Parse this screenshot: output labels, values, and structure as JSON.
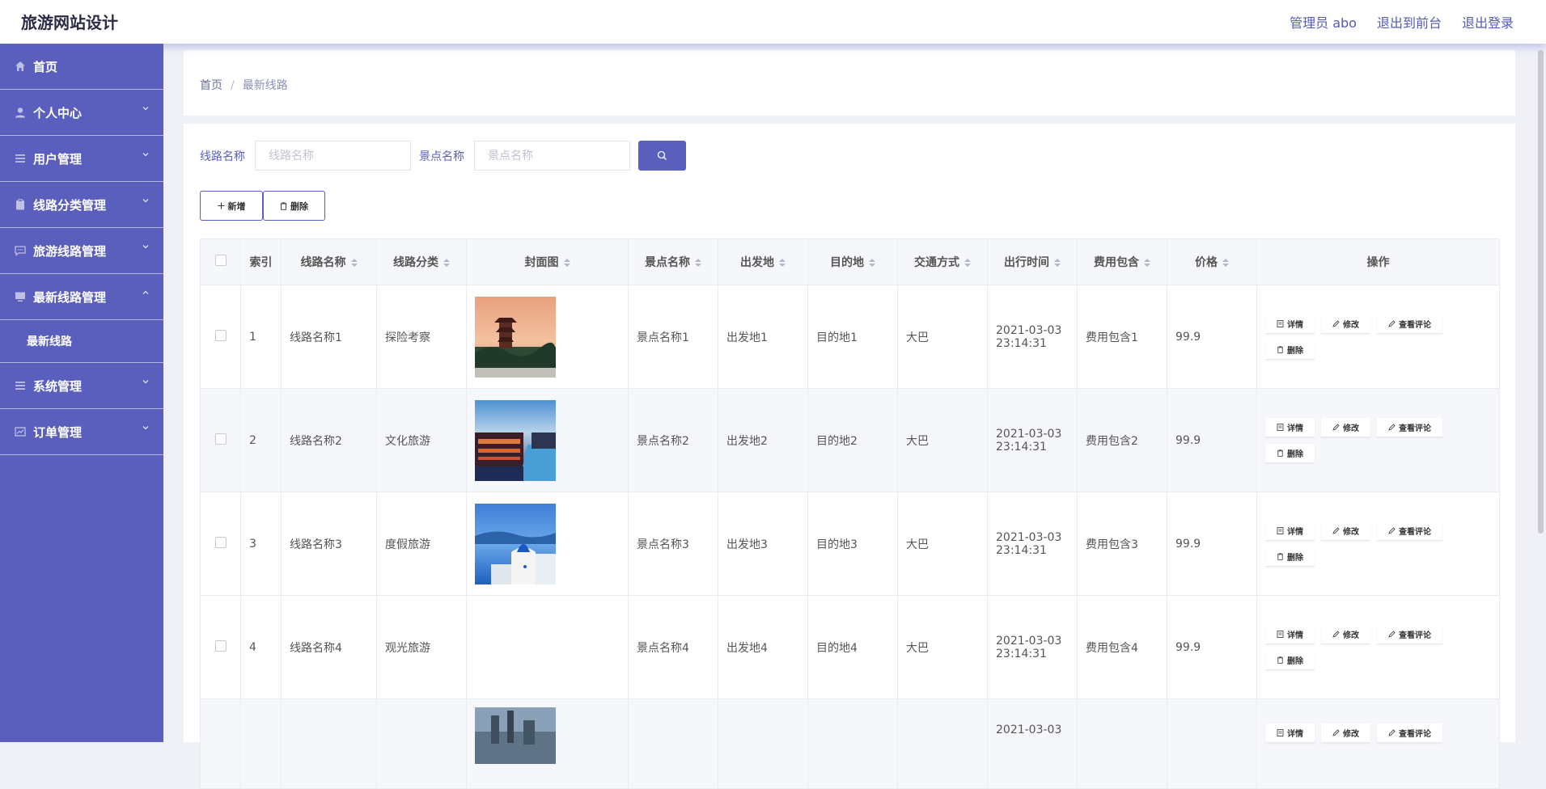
{
  "brand": "旅游网站设计",
  "topnav": {
    "user": "管理员 abo",
    "to_front": "退出到前台",
    "logout": "退出登录"
  },
  "sidebar": {
    "items": [
      {
        "label": "首页",
        "icon": "home-icon"
      },
      {
        "label": "个人中心",
        "icon": "user-icon"
      },
      {
        "label": "用户管理",
        "icon": "list-icon"
      },
      {
        "label": "线路分类管理",
        "icon": "clipboard-icon"
      },
      {
        "label": "旅游线路管理",
        "icon": "chat-icon"
      },
      {
        "label": "最新线路管理",
        "icon": "monitor-icon"
      },
      {
        "label": "系统管理",
        "icon": "list-icon"
      },
      {
        "label": "订单管理",
        "icon": "chart-icon"
      }
    ],
    "sub_item": "最新线路"
  },
  "breadcrumb": {
    "home": "首页",
    "sep": "/",
    "current": "最新线路"
  },
  "search": {
    "route_label": "线路名称",
    "route_placeholder": "线路名称",
    "spot_label": "景点名称",
    "spot_placeholder": "景点名称"
  },
  "actions": {
    "add": "新增",
    "delete": "删除"
  },
  "table": {
    "headers": [
      "索引",
      "线路名称",
      "线路分类",
      "封面图",
      "景点名称",
      "出发地",
      "目的地",
      "交通方式",
      "出行时间",
      "费用包含",
      "价格",
      "操作"
    ],
    "ops": {
      "detail": "详情",
      "edit": "修改",
      "comments": "查看评论",
      "delete": "删除"
    },
    "rows": [
      {
        "idx": "1",
        "name": "线路名称1",
        "category": "探险考察",
        "spot": "景点名称1",
        "from": "出发地1",
        "to": "目的地1",
        "transport": "大巴",
        "date": "2021-03-03",
        "time": "23:14:31",
        "fee": "费用包含1",
        "price": "99.9",
        "cover": "pagoda-sunset"
      },
      {
        "idx": "2",
        "name": "线路名称2",
        "category": "文化旅游",
        "spot": "景点名称2",
        "from": "出发地2",
        "to": "目的地2",
        "transport": "大巴",
        "date": "2021-03-03",
        "time": "23:14:31",
        "fee": "费用包含2",
        "price": "99.9",
        "cover": "water-town-night"
      },
      {
        "idx": "3",
        "name": "线路名称3",
        "category": "度假旅游",
        "spot": "景点名称3",
        "from": "出发地3",
        "to": "目的地3",
        "transport": "大巴",
        "date": "2021-03-03",
        "time": "23:14:31",
        "fee": "费用包含3",
        "price": "99.9",
        "cover": "santorini"
      },
      {
        "idx": "4",
        "name": "线路名称4",
        "category": "观光旅游",
        "spot": "景点名称4",
        "from": "出发地4",
        "to": "目的地4",
        "transport": "大巴",
        "date": "2021-03-03",
        "time": "23:14:31",
        "fee": "费用包含4",
        "price": "99.9",
        "cover": ""
      },
      {
        "date": "2021-03-03",
        "cover": "city-skyline"
      }
    ]
  },
  "colors": {
    "accent": "#5a5fbe",
    "topnav_text": "#5359b9"
  }
}
